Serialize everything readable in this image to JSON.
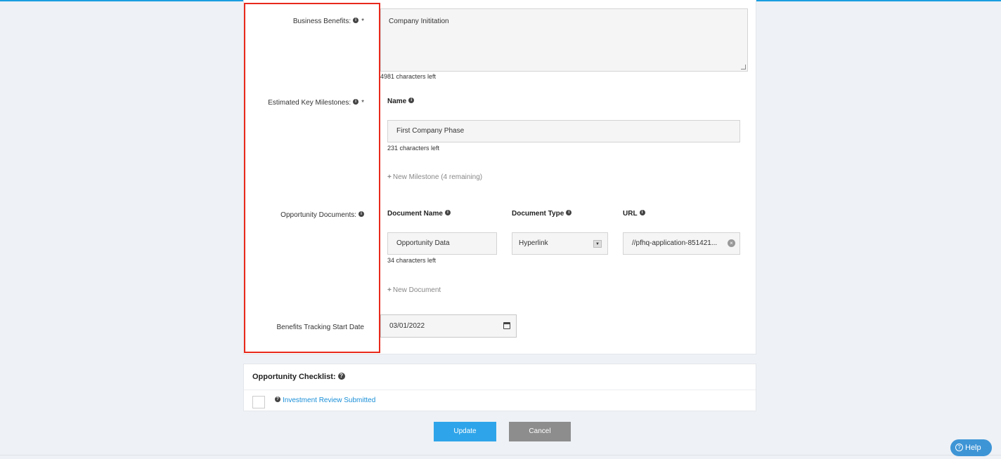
{
  "form": {
    "business_benefits": {
      "label": "Business Benefits:",
      "required_mark": "*",
      "value": "Company Inititation",
      "chars_left": "4981 characters left"
    },
    "milestones": {
      "label": "Estimated Key Milestones:",
      "required_mark": "*",
      "name_header": "Name",
      "name_value": "First Company Phase",
      "chars_left": "231 characters left",
      "add_label": "New Milestone (4 remaining)"
    },
    "documents": {
      "label": "Opportunity Documents:",
      "headers": {
        "name": "Document Name",
        "type": "Document Type",
        "url": "URL"
      },
      "doc_name": "Opportunity Data",
      "doc_type": "Hyperlink",
      "url_value": "//pfhq-application-851421...",
      "chars_left": "34 characters left",
      "add_label": "New Document"
    },
    "tracking_date": {
      "label": "Benefits Tracking Start Date",
      "value": "03/01/2022"
    }
  },
  "checklist": {
    "title": "Opportunity Checklist:",
    "items": [
      {
        "label": "Investment Review Submitted",
        "checked": false
      }
    ]
  },
  "actions": {
    "update_label": "Update",
    "cancel_label": "Cancel"
  },
  "help": {
    "label": "Help"
  },
  "colors": {
    "accent": "#2ea5ea",
    "highlight": "#e8291c",
    "link": "#1a8fd8"
  }
}
